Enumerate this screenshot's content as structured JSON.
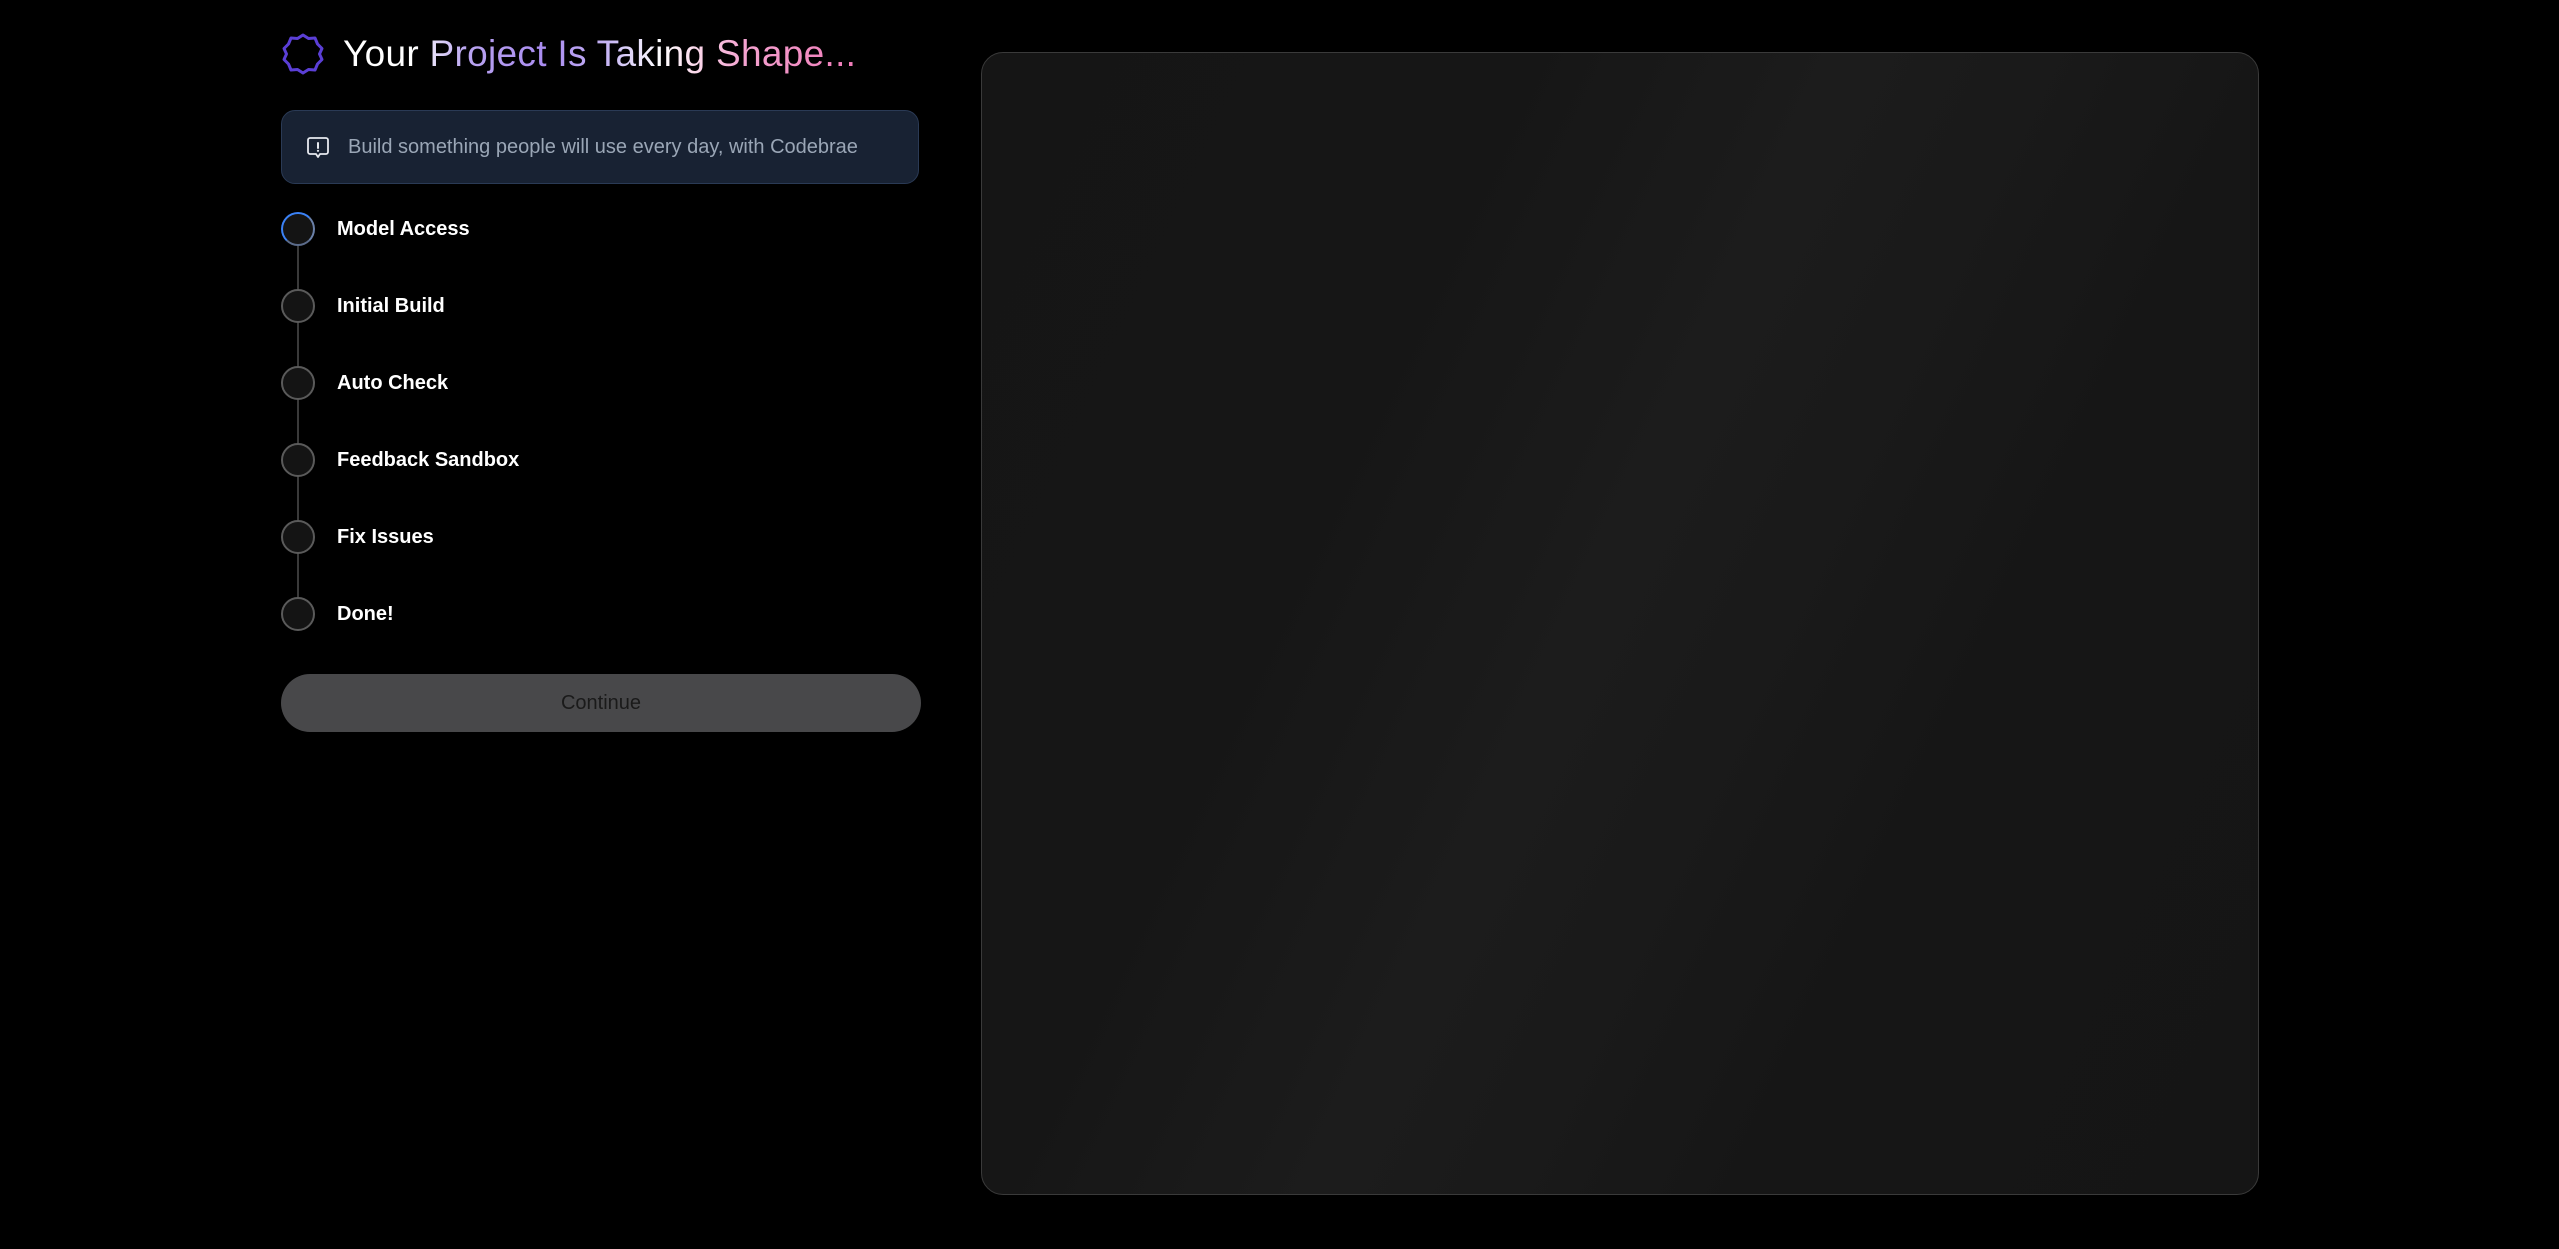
{
  "header": {
    "title": "Your Project Is Taking Shape...",
    "icon": "badge-spinner-icon",
    "accent_color": "#5b3fd6"
  },
  "info": {
    "icon": "info-square-icon",
    "text": "Build something people will use every day, with Codebrae"
  },
  "steps": [
    {
      "label": "Model Access",
      "status": "active"
    },
    {
      "label": "Initial Build",
      "status": "pending"
    },
    {
      "label": "Auto Check",
      "status": "pending"
    },
    {
      "label": "Feedback Sandbox",
      "status": "pending"
    },
    {
      "label": "Fix Issues",
      "status": "pending"
    },
    {
      "label": "Done!",
      "status": "pending"
    }
  ],
  "actions": {
    "continue_label": "Continue"
  },
  "colors": {
    "background": "#000000",
    "info_box_bg": "#182233",
    "active_step": "#3b82f6",
    "button_bg": "#48484a"
  }
}
